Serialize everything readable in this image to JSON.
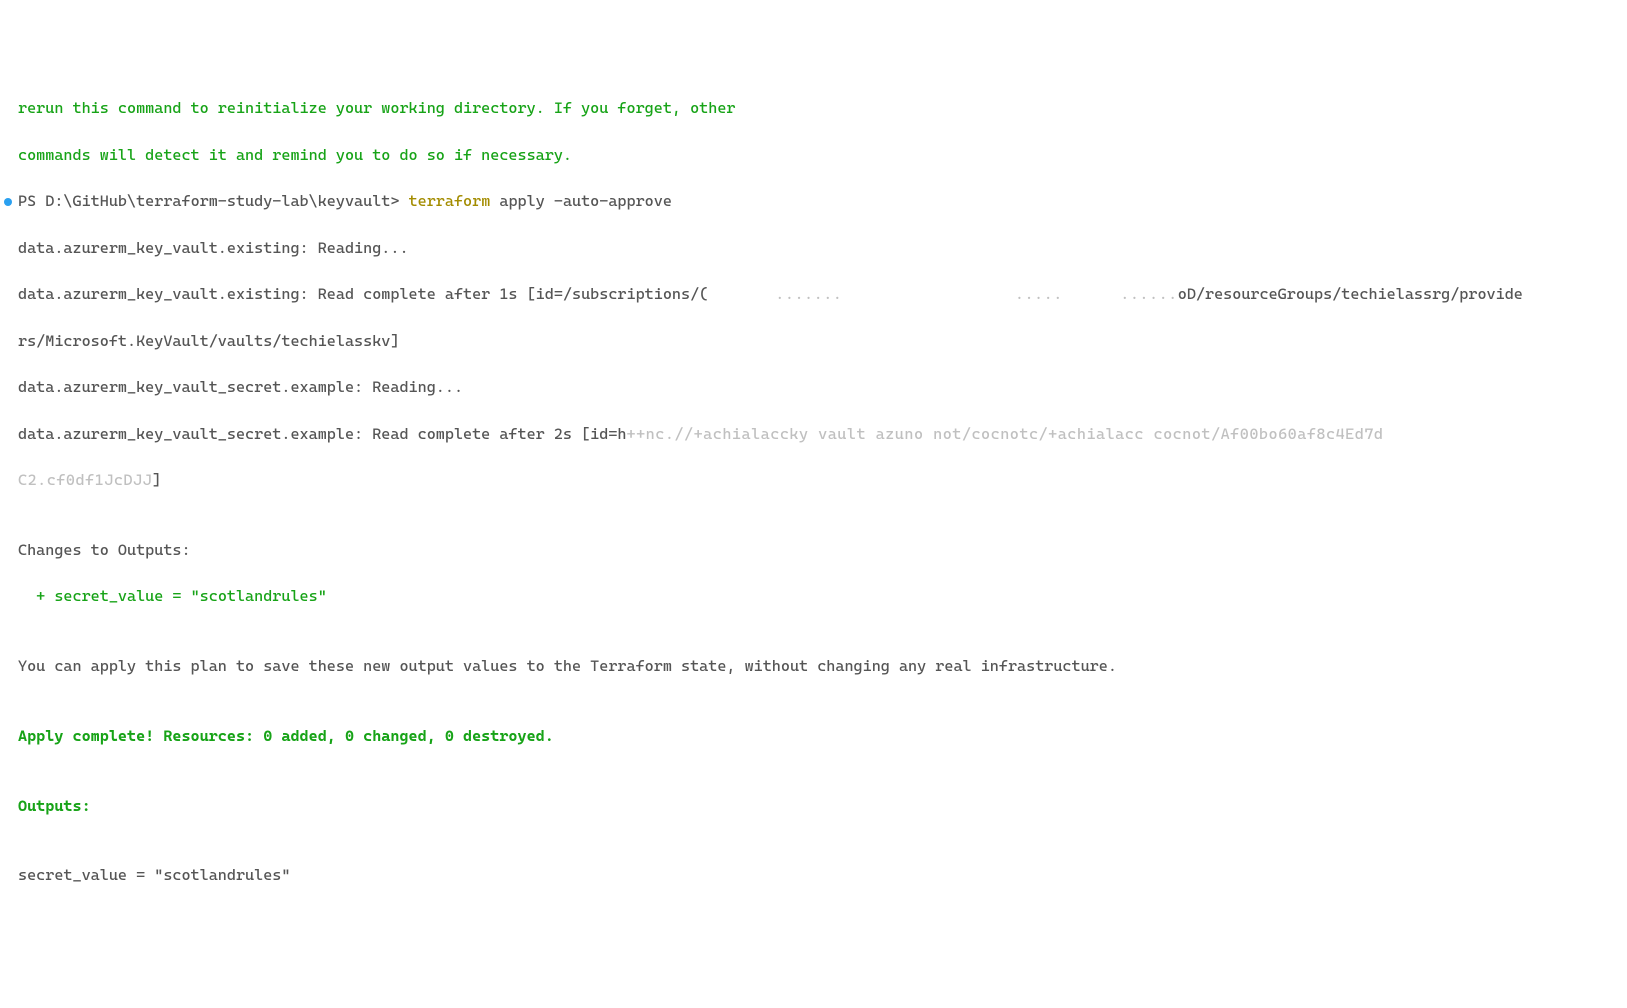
{
  "intro": {
    "line1": "rerun this command to reinitialize your working directory. If you forget, other",
    "line2": "commands will detect it and remind you to do so if necessary."
  },
  "prompt": {
    "ps": "PS ",
    "path": "D:\\GitHub\\terraform-study-lab\\keyvault> ",
    "cmd": "terraform",
    "args": " apply -auto-approve"
  },
  "output": {
    "read1": "data.azurerm_key_vault.existing: Reading...",
    "read2a": "data.azurerm_key_vault.existing: Read complete after 1s [id=/subscriptions/(",
    "read2_redact": "       .......                  .....      ......",
    "read2b": "oD/resourceGroups/techielassrg/provide",
    "read3": "rs/Microsoft.KeyVault/vaults/techielasskv]",
    "read4": "data.azurerm_key_vault_secret.example: Reading...",
    "read5a": "data.azurerm_key_vault_secret.example: Read complete after 2s [id=h",
    "read5_redact": "++nc.//+achialaccky vault azuno not/cocnotc/+achialacc cocnot/Af00bo60af8c4Ed7d",
    "read6_redact": "C2.cf0df1JcDJJ",
    "read6b": "]",
    "blank": "",
    "changes_header": "Changes to Outputs:",
    "changes_line": "  + secret_value = \"scotlandrules\"",
    "plan_msg": "You can apply this plan to save these new output values to the Terraform state, without changing any real infrastructure.",
    "apply_complete": "Apply complete! Resources: 0 added, 0 changed, 0 destroyed.",
    "outputs_header": "Outputs:",
    "secret_out": "secret_value = \"scotlandrules\""
  }
}
